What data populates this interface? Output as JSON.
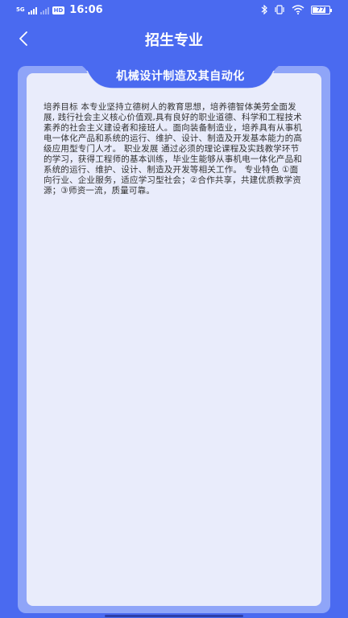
{
  "status_bar": {
    "network_label": "5G",
    "network_label_2": "HD",
    "time": "16:06",
    "battery_level": "77"
  },
  "nav": {
    "title": "招生专业"
  },
  "major": {
    "name": "机械设计制造及其自动化",
    "description": "培养目标 本专业坚持立德树人的教育思想，培养德智体美劳全面发展, 践行社会主义核心价值观,具有良好的职业道德、科学和工程技术素养的社会主义建设者和接班人。面向装备制造业，培养具有从事机电一体化产品和系统的运行、维护、设计、制造及开发基本能力的高级应用型专门人才。 职业发展 通过必须的理论课程及实践教学环节的学习，获得工程师的基本训练，毕业生能够从事机电一体化产品和系统的运行、维护、设计、制造及开发等相关工作。 专业特色 ①面向行业、企业服务，适应学习型社会；②合作共享，共建优质教学资源；③师资一流，质量可靠。"
  },
  "colors": {
    "background": "#4a6af0",
    "card_outer": "#8fa5f8",
    "card_inner": "#e9ecfb",
    "tab": "#4a6af0"
  }
}
